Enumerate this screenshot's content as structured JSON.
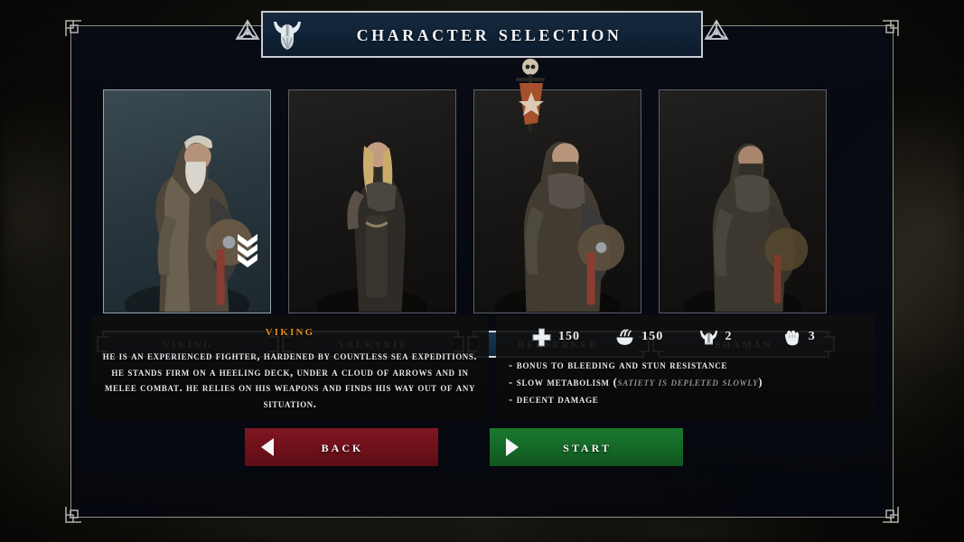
{
  "header": {
    "title": "Character selection",
    "helmet_icon": "viking-helmet-icon",
    "left_ornament": "celtic-knot-ornament",
    "right_ornament": "celtic-knot-ornament"
  },
  "characters": [
    {
      "name": "Viking",
      "selected": true,
      "indicator": "triple-chevron-down-icon"
    },
    {
      "name": "Valkyrie",
      "selected": false,
      "indicator": ""
    },
    {
      "name": "Berserker",
      "selected": false,
      "indicator": ""
    },
    {
      "name": "Shaman",
      "selected": false,
      "indicator": ""
    }
  ],
  "details": {
    "name": "Viking",
    "name_color": "#e08a21",
    "description": "He is an experienced fighter, hardened by countless sea expeditions. He stands firm on a heeling deck, under a cloud of arrows and in melee combat. He relies on his weapons and finds his way out of any situation."
  },
  "stats": [
    {
      "icon": "health-cross-icon",
      "label": "health",
      "value": "150"
    },
    {
      "icon": "food-bowl-icon",
      "label": "satiety",
      "value": "150"
    },
    {
      "icon": "horned-helmet-icon",
      "label": "armor",
      "value": "2"
    },
    {
      "icon": "fist-icon",
      "label": "damage",
      "value": "3"
    }
  ],
  "perks": [
    {
      "text": "- Bonus to bleeding and stun resistance",
      "sub": ""
    },
    {
      "text": "- Slow metabolism (",
      "sub": "satiety is depleted slowly",
      "tail": ")"
    },
    {
      "text": "- Decent damage",
      "sub": ""
    }
  ],
  "buttons": {
    "back": {
      "label": "Back",
      "icon": "left-triangle-icon",
      "color": "#6d1019"
    },
    "start": {
      "label": "Start",
      "icon": "right-triangle-icon",
      "color": "#146626"
    }
  }
}
